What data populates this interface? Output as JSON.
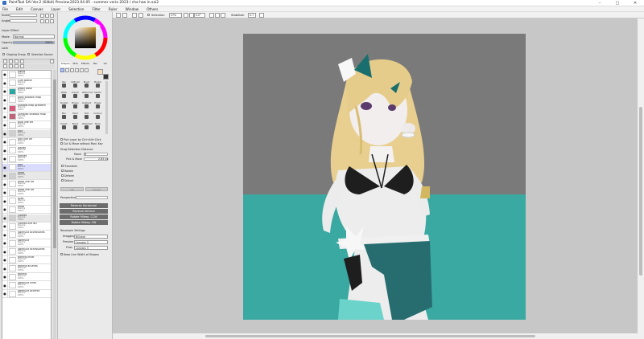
{
  "title": "PaintTool SAI Ver.2 (64bit) Preview.2023.04.05 - summer varia 2023 / cha hae in.sai2",
  "menu": [
    "File",
    "Edit",
    "Canvas",
    "Layer",
    "Selection",
    "Filter",
    "Ruler",
    "Window",
    "Others"
  ],
  "brush": {
    "mode_label": "Mode",
    "mode_value": "Normal",
    "opacity_label": "Opacity",
    "opacity_value": "100%",
    "lock_label": "Lock",
    "clipping_label": "Clipping Group",
    "selection_source_label": "Selection Source",
    "layer_effect_label": "Layer Effect",
    "scale_label": "Scale",
    "angle_label": "Angle"
  },
  "layers": [
    {
      "name": "frame",
      "mode": "Normal",
      "op": "100%",
      "type": "layer",
      "thumb": "#ffffff"
    },
    {
      "name": "cum sketch",
      "mode": "Normal",
      "op": "100%",
      "type": "layer",
      "thumb": "#ffffff"
    },
    {
      "name": "water base",
      "mode": "Normal",
      "op": "100%",
      "type": "layer",
      "thumb": "#2aa7a0"
    },
    {
      "name": "base shadow map",
      "mode": "Normal",
      "op": "100%",
      "type": "layer",
      "thumb": "#ffffff"
    },
    {
      "name": "shadow map gradient",
      "mode": "Normal",
      "op": "100%",
      "type": "layer",
      "thumb": "#d85a78"
    },
    {
      "name": "complex shadow map",
      "mode": "Normal",
      "op": "100%",
      "type": "layer",
      "thumb": "#c06478"
    },
    {
      "name": "bulb line art",
      "mode": "Normal",
      "op": "100%",
      "type": "layer",
      "thumb": "#ffffff"
    },
    {
      "name": "hair",
      "mode": "Normal",
      "op": "100%",
      "type": "folder",
      "thumb": ""
    },
    {
      "name": "hair line art",
      "mode": "Normal",
      "op": "100%",
      "type": "layer",
      "thumb": "#ffffff"
    },
    {
      "name": "lashes",
      "mode": "Normal",
      "op": "100%",
      "type": "layer",
      "thumb": "#ffffff"
    },
    {
      "name": "flashes",
      "mode": "Normal",
      "op": "100%",
      "type": "layer",
      "thumb": "#ffffff"
    },
    {
      "name": "hair",
      "mode": "Normal",
      "op": "100%",
      "type": "layer",
      "thumb": "#ffffff",
      "sel": true
    },
    {
      "name": "head",
      "mode": "Normal",
      "op": "100%",
      "type": "folder",
      "thumb": ""
    },
    {
      "name": "head line art",
      "mode": "Normal",
      "op": "100%",
      "type": "layer",
      "thumb": "#ffffff"
    },
    {
      "name": "head line art",
      "mode": "Normal",
      "op": "100%",
      "type": "layer",
      "thumb": "#ffffff"
    },
    {
      "name": "eyes",
      "mode": "Normal",
      "op": "100%",
      "type": "layer",
      "thumb": "#ffffff"
    },
    {
      "name": "head",
      "mode": "Normal",
      "op": "100%",
      "type": "layer",
      "thumb": "#ffffff"
    },
    {
      "name": "clothes",
      "mode": "Normal",
      "op": "100%",
      "type": "folder",
      "thumb": ""
    },
    {
      "name": "clothes line art",
      "mode": "Normal",
      "op": "100%",
      "type": "layer",
      "thumb": "#ffffff"
    },
    {
      "name": "swimsuit accessories",
      "mode": "Normal",
      "op": "100%",
      "type": "layer",
      "thumb": "#ffffff"
    },
    {
      "name": "swimsuit",
      "mode": "Normal",
      "op": "100%",
      "type": "layer",
      "thumb": "#ffffff"
    },
    {
      "name": "swimsuit accessories",
      "mode": "Normal",
      "op": "100%",
      "type": "layer",
      "thumb": "#ffffff"
    },
    {
      "name": "earring inner",
      "mode": "Normal",
      "op": "100%",
      "type": "layer",
      "thumb": "#ffffff"
    },
    {
      "name": "earring accents",
      "mode": "Normal",
      "op": "100%",
      "type": "layer",
      "thumb": "#ffffff"
    },
    {
      "name": "earring",
      "mode": "Normal",
      "op": "100%",
      "type": "layer",
      "thumb": "#ffffff"
    },
    {
      "name": "swimsuit inner",
      "mode": "Normal",
      "op": "100%",
      "type": "layer",
      "thumb": "#ffffff"
    },
    {
      "name": "swimsuit accents",
      "mode": "Normal",
      "op": "100%",
      "type": "layer",
      "thumb": "#ffffff"
    }
  ],
  "tool_tabs": [
    "Shapes",
    "Mob",
    "Effects",
    "Pen",
    "Ink"
  ],
  "tools": [
    {
      "name": "Pen"
    },
    {
      "name": "AirBrush"
    },
    {
      "name": "Brush"
    },
    {
      "name": "Marker"
    },
    {
      "name": "Water"
    },
    {
      "name": "Crayon"
    },
    {
      "name": "Watercolor"
    },
    {
      "name": "Sketch"
    },
    {
      "name": "Bucket"
    },
    {
      "name": "Binary"
    },
    {
      "name": "Gradient"
    },
    {
      "name": "Eraser"
    },
    {
      "name": "Blur"
    },
    {
      "name": "Hand"
    },
    {
      "name": "Text"
    },
    {
      "name": "Contour"
    },
    {
      "name": "Hands"
    },
    {
      "name": "Blend"
    },
    {
      "name": "Wideshad"
    },
    {
      "name": "Block"
    }
  ],
  "options": {
    "pick_layer": "Pick Layer by Ctrl+Alt+Click",
    "cut_move": "Cut & Move without Mod. Key",
    "drag_detection": "Drag Detection Distance",
    "move_label": "Move",
    "move_value": "8",
    "pick_move_label": "Pick & Move",
    "pick_move_value": "2.85 px",
    "check_items": [
      "Transform",
      "Rotate",
      "Deform",
      "Distort"
    ],
    "btn_ok": "OK",
    "btn_cancel": "Cancel",
    "perspective_label": "Perspective",
    "reverse_h": "Reverse Horizontal",
    "reverse_v": "Reverse Vertical",
    "rotate_cw": "Rotate 90deg. CCW",
    "rotate_ccw": "Rotate 90deg. CW",
    "resample_label": "Resample Settings",
    "dragging_label": "Dragging",
    "dragging_value": "Bilinear",
    "preview_label": "Preview",
    "preview_value": "Lanczos 3",
    "final_label": "Final",
    "final_value": "Lanczos 3",
    "keep_line": "Keep Line Width of Shapes"
  },
  "canvas_toolbar": {
    "selection_label": "Selection",
    "zoom_value": "37%",
    "angle_value": "0.0°",
    "stabilizer_label": "Stabilizer",
    "stabilizer_value": "S-7"
  },
  "colors": {
    "canvas_bg": "#c7c7c7",
    "paper_gray": "#7a7a7a",
    "water": "#3aa9a2",
    "accent_teal": "#1a6f6e"
  }
}
